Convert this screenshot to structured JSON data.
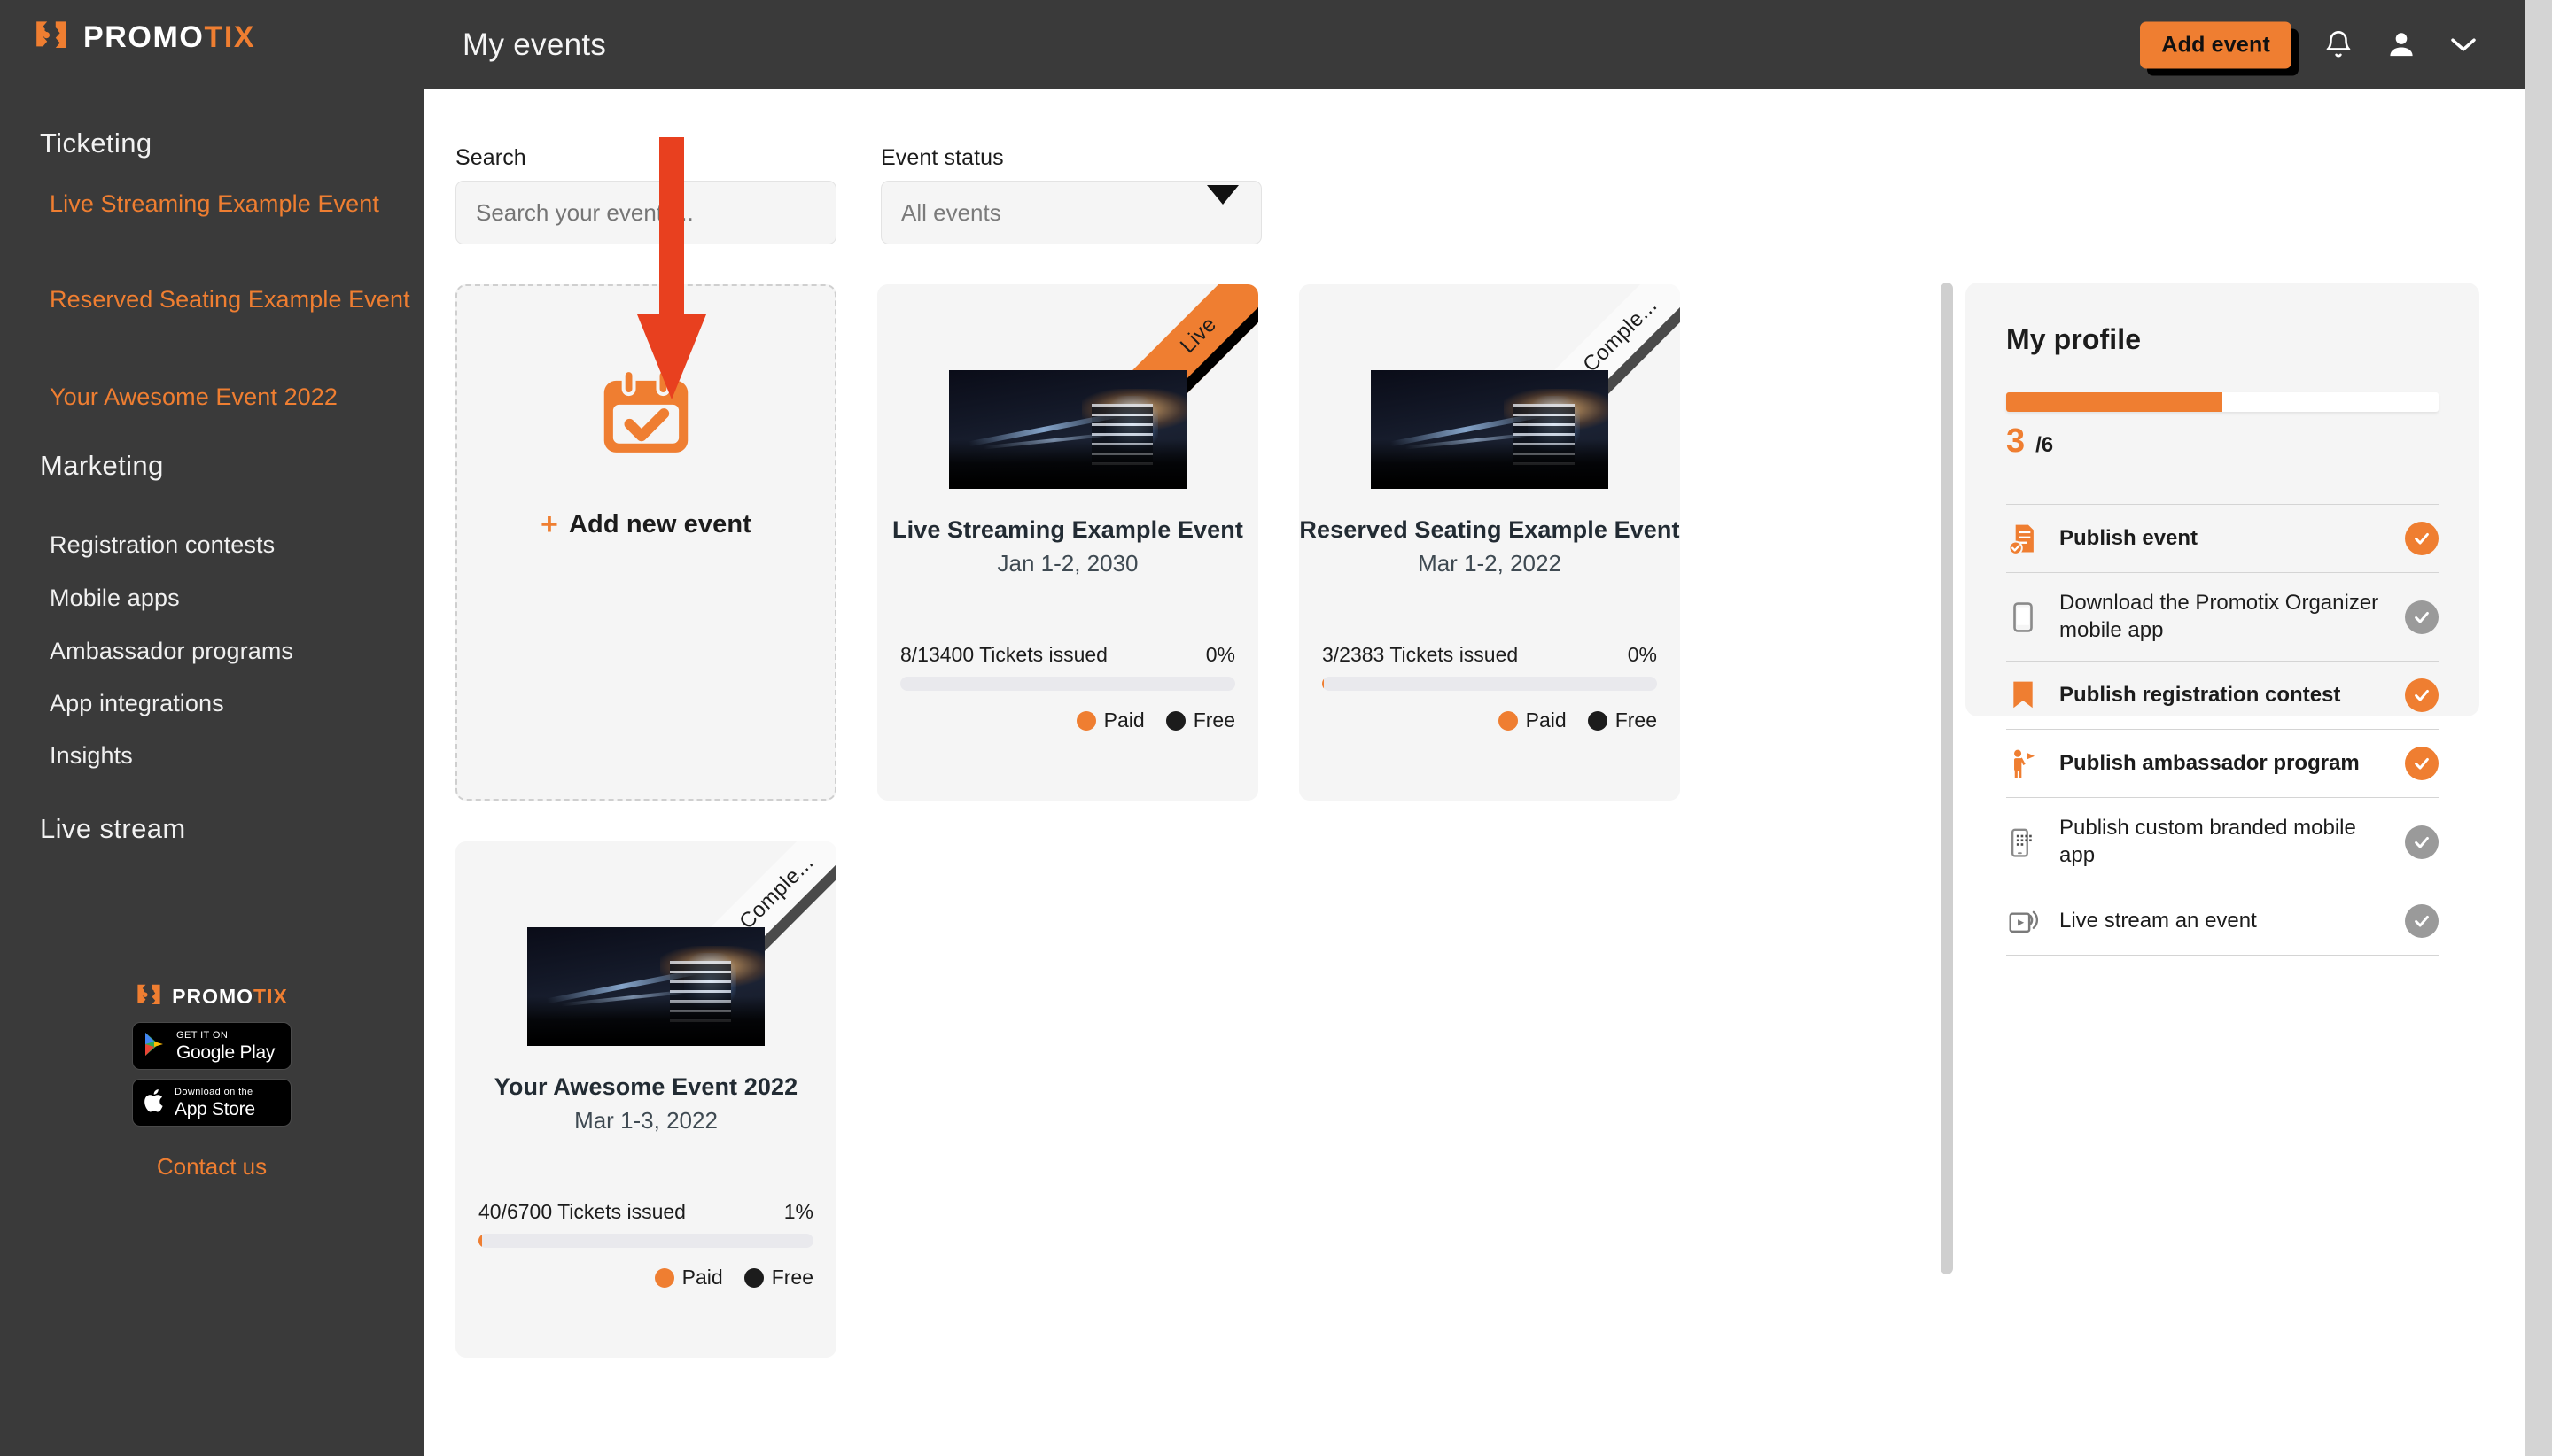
{
  "brand": {
    "name_prefix": "PROMO",
    "name_suffix": "TIX",
    "accent_color": "#ef7e31",
    "dark_color": "#3a3a3a"
  },
  "sidebar": {
    "sections": [
      {
        "label": "Ticketing"
      },
      {
        "label": "Marketing"
      },
      {
        "label": "Live stream"
      }
    ],
    "ticketing_links": [
      {
        "label": "Live Streaming Example Event"
      },
      {
        "label": "Reserved Seating Example Event"
      },
      {
        "label": "Your Awesome Event 2022"
      }
    ],
    "marketing_links": [
      {
        "label": "Registration contests"
      },
      {
        "label": "Mobile apps"
      },
      {
        "label": "Ambassador programs"
      },
      {
        "label": "App integrations"
      },
      {
        "label": "Insights"
      }
    ],
    "footer": {
      "google_play_small": "GET IT ON",
      "google_play_big": "Google Play",
      "app_store_small": "Download on the",
      "app_store_big": "App Store",
      "contact": "Contact us"
    }
  },
  "header": {
    "title": "My events",
    "add_event_label": "Add event",
    "bell_icon": "notification-bell-icon",
    "user_icon": "user-avatar-icon",
    "chevron_icon": "chevron-down-icon"
  },
  "filters": {
    "search_label": "Search",
    "search_value": "",
    "search_placeholder": "Search your events...",
    "status_label": "Event status",
    "status_selected": "All events"
  },
  "add_card": {
    "label": "Add new event",
    "plus": "+",
    "icon": "calendar-check-icon"
  },
  "events": [
    {
      "title": "Live Streaming Example Event",
      "date": "Jan 1-2, 2030",
      "ribbon": "Live",
      "ribbon_type": "live",
      "tickets": "8/13400 Tickets issued",
      "percent": "0%",
      "progress": 0,
      "legend_paid": "Paid",
      "legend_free": "Free"
    },
    {
      "title": "Reserved Seating Example Event",
      "date": "Mar 1-2, 2022",
      "ribbon": "Comple...",
      "ribbon_type": "completed",
      "tickets": "3/2383 Tickets issued",
      "percent": "0%",
      "progress": 0.6,
      "legend_paid": "Paid",
      "legend_free": "Free"
    },
    {
      "title": "Your Awesome Event 2022",
      "date": "Mar 1-3, 2022",
      "ribbon": "Comple...",
      "ribbon_type": "completed",
      "tickets": "40/6700 Tickets issued",
      "percent": "1%",
      "progress": 1,
      "legend_paid": "Paid",
      "legend_free": "Free"
    }
  ],
  "profile": {
    "title": "My profile",
    "completed": "3",
    "total": "/6",
    "progress_percent": 50,
    "items": [
      {
        "label": "Publish event",
        "done": true,
        "bold": true,
        "icon": "document-check-icon"
      },
      {
        "label": "Download the Promotix Organizer mobile app",
        "done": false,
        "bold": false,
        "icon": "mobile-phone-icon"
      },
      {
        "label": "Publish registration contest",
        "done": true,
        "bold": true,
        "icon": "bookmark-ribbon-icon"
      },
      {
        "label": "Publish ambassador program",
        "done": true,
        "bold": true,
        "icon": "person-megaphone-icon"
      },
      {
        "label": "Publish custom branded mobile app",
        "done": false,
        "bold": false,
        "icon": "branded-app-icon"
      },
      {
        "label": "Live stream an event",
        "done": false,
        "bold": false,
        "icon": "live-stream-icon"
      }
    ]
  },
  "annotation": {
    "arrow_color": "#e8401f",
    "arrow_direction": "down"
  }
}
